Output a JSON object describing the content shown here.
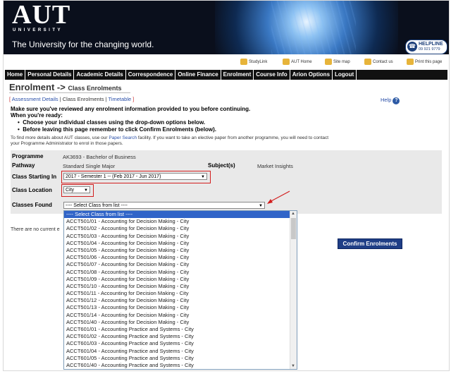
{
  "header": {
    "logo": "AUT",
    "logo_sub": "UNIVERSITY",
    "tagline": "The University for the changing world.",
    "helpline_title": "HELPLINE",
    "helpline_number": "09 921 9779"
  },
  "quick_links": [
    "StudyLink",
    "AUT Home",
    "Site map",
    "Contact us",
    "Print this page"
  ],
  "nav": [
    "Home",
    "Personal Details",
    "Academic Details",
    "Correspondence",
    "Online Finance",
    "Enrolment",
    "Course Info",
    "Arion Options",
    "Logout"
  ],
  "breadcrumb": {
    "main": "Enrolment",
    "arrow": "->",
    "sub": "Class Enrolments"
  },
  "tabs": {
    "assessment": "Assessment Details",
    "class": "Class Enrolments",
    "timetable": "Timetable"
  },
  "help_label": "Help",
  "instructions": {
    "line1": "Make sure you've reviewed any enrolment information provided to you before continuing.",
    "line2": "When you're ready:",
    "bullet1": "Choose your individual classes using the drop-down options below.",
    "bullet2": "Before leaving this page remember to click Confirm Enrolments (below).",
    "note_pre": "To find more details about AUT classes, use our",
    "note_link": "Paper Search",
    "note_post": "facility. If you want to take an elective paper from another programme, you will need to contact",
    "note_line2": "your Programme Administrator to enrol in those papers."
  },
  "form": {
    "programme_label": "Programme",
    "programme_value": "AK3693 - Bachelor of Business",
    "pathway_label": "Pathway",
    "pathway_value": "Standard Single Major",
    "subjects_label": "Subject(s)",
    "subjects_value": "Market Insights",
    "class_starting_label": "Class Starting In",
    "class_starting_value": "2017 - Semester 1 -- (Feb 2017 - Jun 2017)",
    "class_location_label": "Class Location",
    "class_location_value": "City",
    "classes_found_label": "Classes Found",
    "classes_found_value": "---- Select Class from list ----"
  },
  "no_classes_text": "There are no current e",
  "confirm_label": "Confirm Enrolments",
  "dropdown_options": [
    "---- Select Class from list ----",
    "ACCT501/01 - Accounting for Decision Making - City",
    "ACCT501/02 - Accounting for Decision Making - City",
    "ACCT501/03 - Accounting for Decision Making - City",
    "ACCT501/04 - Accounting for Decision Making - City",
    "ACCT501/05 - Accounting for Decision Making - City",
    "ACCT501/06 - Accounting for Decision Making - City",
    "ACCT501/07 - Accounting for Decision Making - City",
    "ACCT501/08 - Accounting for Decision Making - City",
    "ACCT501/09 - Accounting for Decision Making - City",
    "ACCT501/10 - Accounting for Decision Making - City",
    "ACCT501/11 - Accounting for Decision Making - City",
    "ACCT501/12 - Accounting for Decision Making - City",
    "ACCT501/13 - Accounting for Decision Making - City",
    "ACCT501/14 - Accounting for Decision Making - City",
    "ACCT501/40 - Accounting for Decision Making - City",
    "ACCT601/01 - Accounting Practice and Systems - City",
    "ACCT601/02 - Accounting Practice and Systems - City",
    "ACCT601/03 - Accounting Practice and Systems - City",
    "ACCT601/04 - Accounting Practice and Systems - City",
    "ACCT601/05 - Accounting Practice and Systems - City",
    "ACCT601/40 - Accounting Practice and Systems - City"
  ],
  "colors": {
    "nav_bg": "#111111",
    "link": "#2a4fa8",
    "highlight_border": "#d21d1d",
    "confirm_bg": "#1f3e86",
    "selected_option": "#3064c8"
  }
}
